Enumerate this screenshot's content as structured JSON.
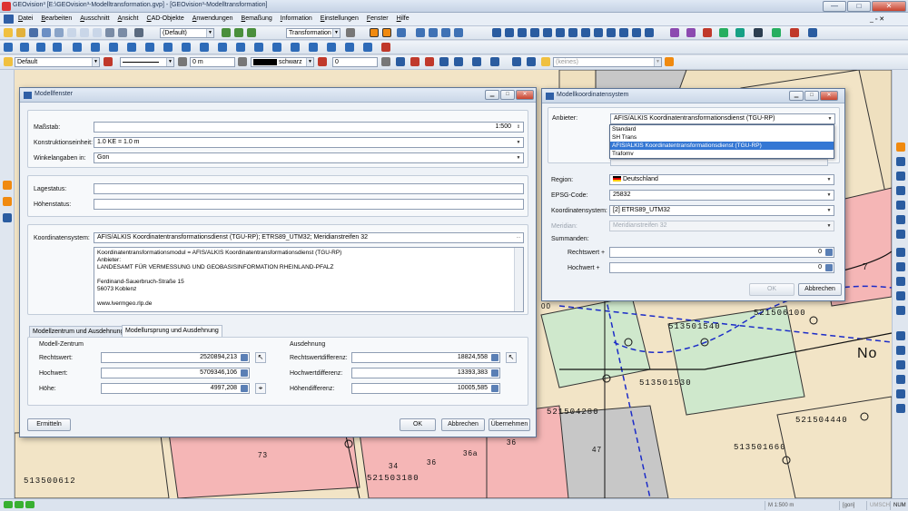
{
  "window": {
    "title": "GEOvision³ [E:\\GEOvision³-Modelltransformation.gvp] - [GEOvision³-Modelltransformation]",
    "min_label": "—",
    "max_label": "□",
    "close_label": "✕"
  },
  "menu": {
    "items": [
      "Datei",
      "Bearbeiten",
      "Ausschnitt",
      "Ansicht",
      "CAD-Objekte",
      "Anwendungen",
      "Bemaßung",
      "Information",
      "Einstellungen",
      "Fenster",
      "Hilfe"
    ],
    "right_controls": "_ ▫ ✕"
  },
  "toolbar1": {
    "scale_combo": "(Default)",
    "transform_combo": "Transformation"
  },
  "toolbar2": {},
  "toolbar3": {
    "layer_combo": "Default",
    "height_value": "0 m",
    "color_label": "schwarz",
    "number_value": "0",
    "style_combo": "(keines)"
  },
  "modellfenster": {
    "title": "Modellfenster",
    "massstab_label": "Maßstab:",
    "massstab_value": "1:500",
    "konstruktionseinheit_label": "Konstruktionseinheit:",
    "konstruktionseinheit_value": "1.0 KE  =  1.0 m",
    "winkelangaben_label": "Winkelangaben in:",
    "winkelangaben_value": "Gon",
    "lagestatus_label": "Lagestatus:",
    "hoehenstatus_label": "Höhenstatus:",
    "koordinatensystem_label": "Koordinatensystem:",
    "koordinatensystem_value": "AFIS/ALKIS Koordinatentransformationsdienst (TGU-RP); ETRS89_UTM32; Meridianstreifen 32",
    "info_lines": [
      "Koordinatentransformationsmodul = AFIS/ALKIS Koordinatentransformationsdienst (TGU-RP)",
      "Anbieter:",
      "LANDESAMT FÜR VERMESSUNG UND GEOBASISINFORMATION RHEINLAND-PFALZ",
      "",
      "Ferdinand-Sauerbruch-Straße 15",
      "56073 Koblenz",
      "",
      "www.lvermgeo.rlp.de"
    ],
    "tabs": [
      "Modellzentrum und Ausdehnung",
      "Modellursprung und Ausdehnung"
    ],
    "modellzentrum_group": "Modell-Zentrum",
    "rechtswert_label": "Rechtswert:",
    "rechtswert_value": "2520894,213",
    "hochwert_label": "Hochwert:",
    "hochwert_value": "5709346,106",
    "hoehe_label": "Höhe:",
    "hoehe_value": "4997,208",
    "ausdehnung_group": "Ausdehnung",
    "rechtswertdiff_label": "Rechtswertdifferenz:",
    "rechtswertdiff_value": "18824,558",
    "hochwertdiff_label": "Hochwertdifferenz:",
    "hochwertdiff_value": "13393,383",
    "hoehendiff_label": "Höhendifferenz:",
    "hoehendiff_value": "10005,585",
    "ermitteln_button": "Ermitteln",
    "ok_button": "OK",
    "abbrechen_button": "Abbrechen",
    "uebernehmen_button": "Übernehmen"
  },
  "koordsystem": {
    "title": "Modellkoordinatensystem",
    "anbieter_label": "Anbieter:",
    "anbieter_value": "AFIS/ALKIS Koordinatentransformationsdienst (TGU-RP)",
    "dropdown_options": [
      "Standard",
      "SH Trans",
      "AFIS/ALKIS Koordinatentransformationsdienst (TGU-RP)",
      "Trafomv"
    ],
    "region_label": "Region:",
    "region_value": "Deutschland",
    "epsg_label": "EPSG-Code:",
    "epsg_value": "25832",
    "koordsys_label": "Koordinatensystem:",
    "koordsys_value": "[2] ETRS89_UTM32",
    "meridian_label": "Meridian:",
    "meridian_value": "Meridianstreifen 32",
    "summanden_label": "Summanden:",
    "rechtswert_label": "Rechtswert +",
    "rechtswert_value": "0",
    "hochwert_label": "Hochwert +",
    "hochwert_value": "0",
    "ok_button": "OK",
    "abbrechen_button": "Abbrechen"
  },
  "map": {
    "labels": [
      "521506100",
      "513501540",
      "513501530",
      "521504280",
      "521504440",
      "513501660",
      "521503180",
      "513500612",
      "No",
      "7",
      "36",
      "36a",
      "34",
      "73",
      "47",
      "00",
      "36"
    ]
  },
  "statusbar": {
    "scale": "M 1:500  m",
    "unit": "[gon]",
    "caps": "UMSCH",
    "num": "NUM"
  }
}
